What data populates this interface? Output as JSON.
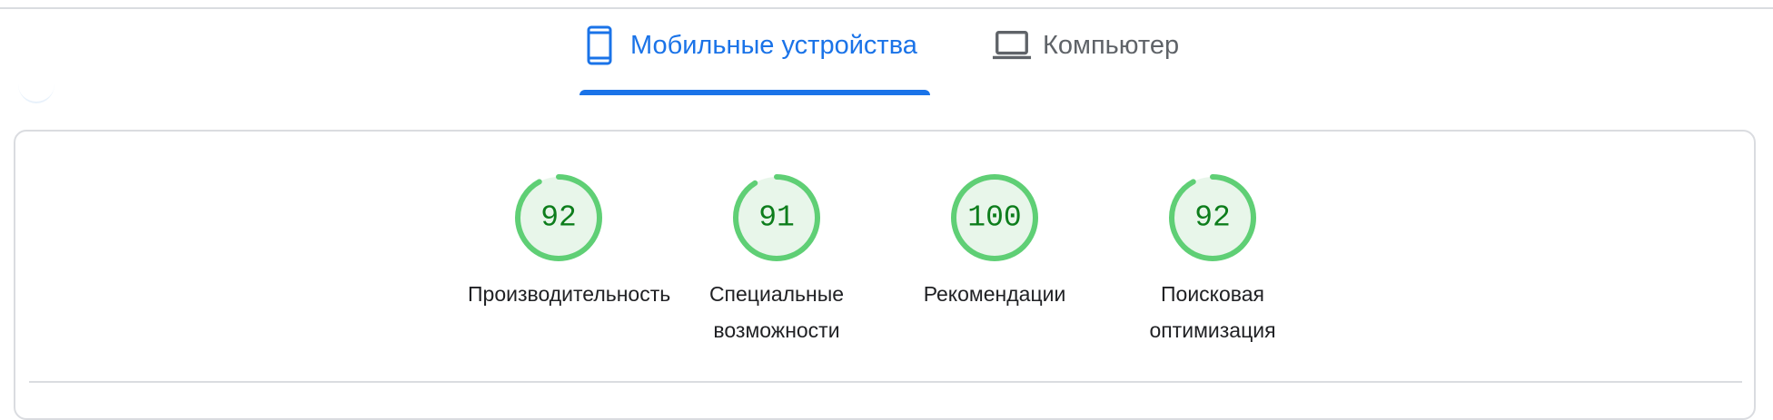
{
  "tabs": [
    {
      "label": "Мобильные устройства",
      "icon": "smartphone-icon",
      "active": true
    },
    {
      "label": "Компьютер",
      "icon": "laptop-icon",
      "active": false
    }
  ],
  "colors": {
    "accent": "#1a73e8",
    "pass_green": "#5fcf75",
    "pass_fill": "#e8f6ea",
    "score_text": "#0d7d1c"
  },
  "scores": [
    {
      "value": 92,
      "label_lines": [
        "Производительность"
      ]
    },
    {
      "value": 91,
      "label_lines": [
        "Специальные",
        "возможности"
      ]
    },
    {
      "value": 100,
      "label_lines": [
        "Рекомендации"
      ]
    },
    {
      "value": 92,
      "label_lines": [
        "Поисковая",
        "оптимизация"
      ]
    }
  ]
}
